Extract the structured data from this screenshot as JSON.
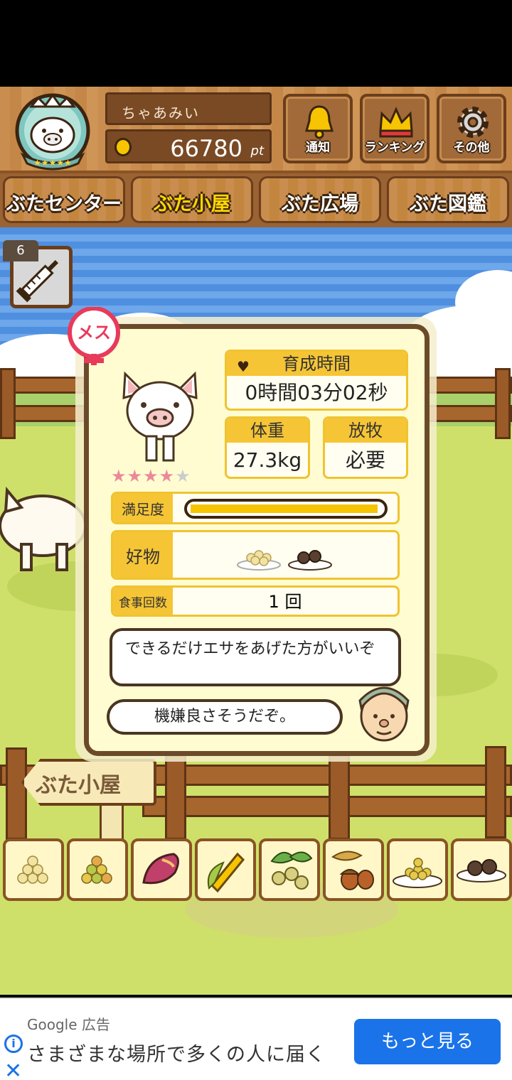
{
  "header": {
    "player_name": "ちゃあみい",
    "points": "66780",
    "points_unit": "pt",
    "buttons": [
      {
        "label": "通知",
        "icon": "bell-icon"
      },
      {
        "label": "ランキング",
        "icon": "crown-icon"
      },
      {
        "label": "その他",
        "icon": "gear-icon"
      }
    ]
  },
  "tabs": [
    {
      "label": "ぶたセンター"
    },
    {
      "label": "ぶた小屋",
      "active": true
    },
    {
      "label": "ぶた広場"
    },
    {
      "label": "ぶた図鑑"
    }
  ],
  "item_badge": {
    "count": "6",
    "icon": "syringe-icon"
  },
  "pig_card": {
    "gender_label": "メス",
    "stars": 4,
    "stars_max": 5,
    "growth_time_label": "育成時間",
    "growth_time_value": "0時間03分02秒",
    "weight_label": "体重",
    "weight_value": "27.3kg",
    "grazing_label": "放牧",
    "grazing_value": "必要",
    "satisfaction_label": "満足度",
    "satisfaction_level": 0.98,
    "favorite_label": "好物",
    "favorite_icons": [
      "grain-plate-icon",
      "meatball-plate-icon"
    ],
    "meal_count_label": "食事回数",
    "meal_count_value": "1 回",
    "advice_text": "できるだけエサをあげた方がいいぞ",
    "mood_text": "機嫌良さそうだぞ。"
  },
  "scene": {
    "sign_label": "ぶた小屋"
  },
  "food_items": [
    {
      "icon": "soybean-icon"
    },
    {
      "icon": "mixed-grain-icon"
    },
    {
      "icon": "sweet-potato-icon"
    },
    {
      "icon": "corn-icon"
    },
    {
      "icon": "olive-icon"
    },
    {
      "icon": "acorn-icon"
    },
    {
      "icon": "grain-plate-icon"
    },
    {
      "icon": "meatball-plate-icon"
    }
  ],
  "ad": {
    "label": "Google 広告",
    "text": "さまざまな場所で多くの人に届く",
    "button": "もっと見る"
  },
  "colors": {
    "wood": "#c98d4f",
    "accent_yellow": "#f6c535",
    "sky": "#4f8fe0",
    "grass": "#cfe06a",
    "ad_blue": "#1a73e8"
  }
}
